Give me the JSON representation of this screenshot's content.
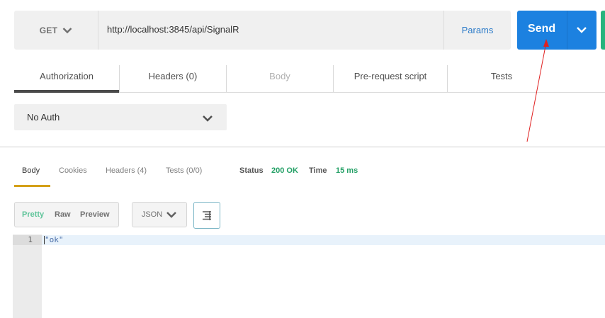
{
  "request": {
    "method": "GET",
    "url": "http://localhost:3845/api/SignalR",
    "params_label": "Params",
    "send_label": "Send"
  },
  "request_tabs": [
    {
      "label": "Authorization",
      "active": true
    },
    {
      "label": "Headers (0)",
      "active": false
    },
    {
      "label": "Body",
      "active": false,
      "disabled": true
    },
    {
      "label": "Pre-request script",
      "active": false
    },
    {
      "label": "Tests",
      "active": false
    }
  ],
  "auth": {
    "selected": "No Auth"
  },
  "response_tabs": [
    {
      "label": "Body",
      "active": true
    },
    {
      "label": "Cookies",
      "active": false
    },
    {
      "label": "Headers (4)",
      "active": false
    },
    {
      "label": "Tests (0/0)",
      "active": false
    }
  ],
  "response_meta": {
    "status_label": "Status",
    "status_value": "200 OK",
    "time_label": "Time",
    "time_value": "15 ms"
  },
  "view_modes": [
    "Pretty",
    "Raw",
    "Preview"
  ],
  "active_view": "Pretty",
  "format": "JSON",
  "code": {
    "line_numbers": [
      "1"
    ],
    "lines": [
      "\"ok\""
    ]
  },
  "colors": {
    "send_blue": "#1c81e0",
    "status_green": "#24a066",
    "active_tab_underline": "#d4a017",
    "annotation_red": "#e02020"
  },
  "icons": [
    "chevron-down-icon",
    "wrap-lines-icon"
  ]
}
